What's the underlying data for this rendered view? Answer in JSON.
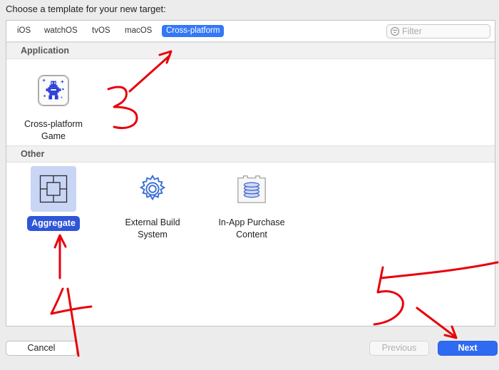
{
  "dialog": {
    "title": "Choose a template for your new target:"
  },
  "platform_tabs": [
    {
      "label": "iOS"
    },
    {
      "label": "watchOS"
    },
    {
      "label": "tvOS"
    },
    {
      "label": "macOS"
    },
    {
      "label": "Cross-platform",
      "selected": true
    }
  ],
  "filter": {
    "placeholder": "Filter",
    "value": "",
    "icon": "filter-icon"
  },
  "sections": {
    "application": {
      "header": "Application",
      "templates": [
        {
          "label": "Cross-platform\nGame",
          "icon": "game-icon"
        }
      ]
    },
    "other": {
      "header": "Other",
      "templates": [
        {
          "label": "Aggregate",
          "icon": "aggregate-icon",
          "selected": true
        },
        {
          "label": "External Build\nSystem",
          "icon": "gear-icon"
        },
        {
          "label": "In-App Purchase\nContent",
          "icon": "in-app-purchase-icon"
        }
      ]
    }
  },
  "buttons": {
    "cancel": "Cancel",
    "previous": "Previous",
    "next": "Next"
  },
  "colors": {
    "accent": "#3478f6",
    "selection": "#2f55d8",
    "annotation": "#e8000b"
  }
}
